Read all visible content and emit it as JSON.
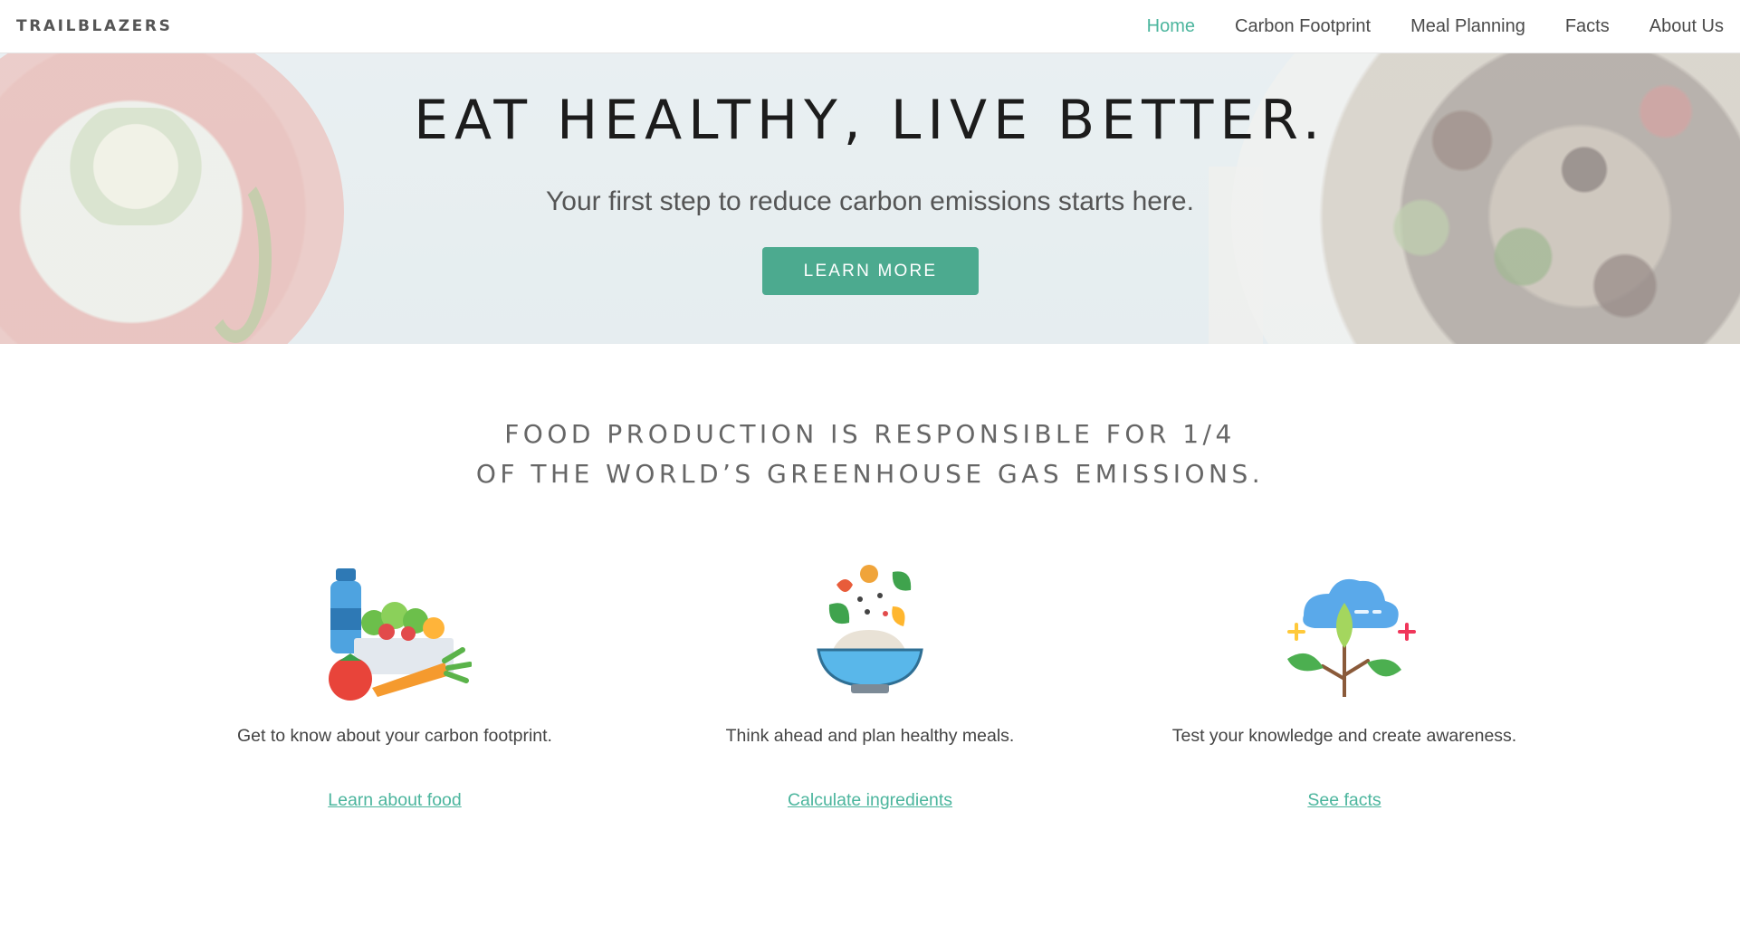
{
  "nav": {
    "brand": "TRAILBLAZERS",
    "links": [
      {
        "label": "Home",
        "active": true
      },
      {
        "label": "Carbon Footprint",
        "active": false
      },
      {
        "label": "Meal Planning",
        "active": false
      },
      {
        "label": "Facts",
        "active": false
      },
      {
        "label": "About Us",
        "active": false
      }
    ]
  },
  "hero": {
    "title": "EAT HEALTHY, LIVE BETTER.",
    "subtitle": "Your first step to reduce carbon emissions starts here.",
    "button_label": "LEARN MORE"
  },
  "statement": {
    "line1": "FOOD PRODUCTION IS RESPONSIBLE FOR 1/4",
    "line2": "OF THE WORLD’S GREENHOUSE GAS EMISSIONS."
  },
  "features": [
    {
      "icon": "groceries-icon",
      "text": "Get to know about your carbon footprint.",
      "link": "Learn about food"
    },
    {
      "icon": "salad-bowl-icon",
      "text": "Think ahead and plan healthy meals.",
      "link": "Calculate ingredients"
    },
    {
      "icon": "growing-plant-icon",
      "text": "Test your knowledge and create awareness.",
      "link": "See facts"
    }
  ],
  "colors": {
    "accent": "#4bb59d",
    "button": "#4caa8f"
  }
}
